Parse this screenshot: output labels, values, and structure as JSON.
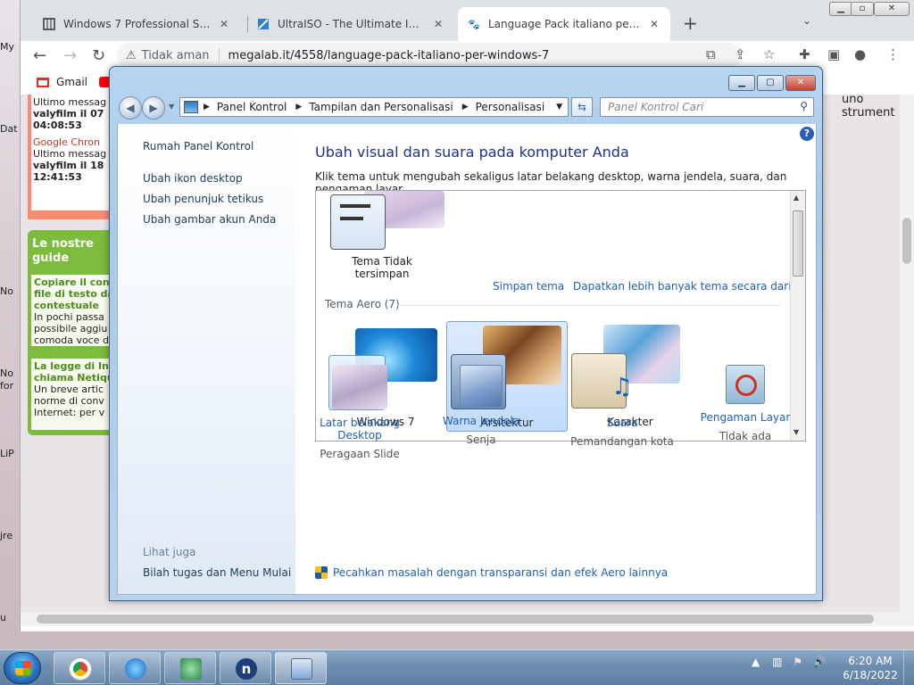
{
  "desktop": {
    "left_labels": [
      "My",
      "Dat",
      "No",
      "No",
      "for",
      "LiP",
      "jre",
      "u"
    ]
  },
  "browser": {
    "tabs": [
      {
        "title": "Windows 7 Professional SP1 (Itali"
      },
      {
        "title": "UltraISO - The Ultimate ISO CD/D"
      },
      {
        "title": "Language Pack italiano per Wind"
      }
    ],
    "address": {
      "security_text": "Tidak aman",
      "url": "megalab.it/4558/language-pack-italiano-per-windows-7"
    },
    "bookmarks": [
      {
        "label": "Gmail"
      }
    ],
    "page": {
      "pink_box_lines": [
        {
          "text": "Ultimo messag",
          "style": "normal"
        },
        {
          "text": "valyfilm il 07",
          "style": "bold"
        },
        {
          "text": "04:08:53",
          "style": "bold"
        },
        {
          "text": "Google Chron",
          "style": "red"
        },
        {
          "text": "Ultimo messag",
          "style": "normal"
        },
        {
          "text": "valyfilm il 18",
          "style": "bold"
        },
        {
          "text": "12:41:53",
          "style": "bold"
        }
      ],
      "green_title": "Le nostre guide",
      "green_items": [
        {
          "title": "Copiare il con file di testo da contestuale",
          "body": "In pochi passa possibile aggiu comoda voce d"
        },
        {
          "title": "La legge di Int chiama Netiqu",
          "body": "Un breve artic norme di conv Internet: per v"
        }
      ],
      "right_text": "uno strument"
    }
  },
  "w7window": {
    "breadcrumb": [
      "Panel Kontrol",
      "Tampilan dan Personalisasi",
      "Personalisasi"
    ],
    "search_placeholder": "Panel Kontrol Cari",
    "sidebar": {
      "links": [
        "Rumah Panel Kontrol",
        "Ubah ikon desktop",
        "Ubah penunjuk tetikus",
        "Ubah gambar akun Anda"
      ],
      "see_also_header": "Lihat juga",
      "see_also_links": [
        "Bilah tugas dan Menu Mulai"
      ]
    },
    "main": {
      "title": "Ubah visual dan suara pada komputer Anda",
      "description": "Klik tema untuk mengubah sekaligus latar belakang desktop, warna jendela, suara, dan pengaman layar.",
      "unsaved_theme": "Tema Tidak tersimpan",
      "save_theme": "Simpan tema",
      "get_more_themes": "Dapatkan lebih banyak tema secara daring",
      "aero_header": "Tema Aero (7)",
      "aero_themes": [
        "Windows 7",
        "Arsitektur",
        "Karakter"
      ],
      "selected_theme": "Arsitektur",
      "bottom_items": [
        {
          "link": "Latar belakang Desktop",
          "sub": "Peragaan Slide"
        },
        {
          "link": "Warna Jendela",
          "sub": "Senja"
        },
        {
          "link": "Suara",
          "sub": "Pemandangan kota"
        },
        {
          "link": "Pengaman Layar",
          "sub": "Tidak ada"
        }
      ],
      "troubleshoot": "Pecahkan masalah dengan transparansi dan efek Aero lainnya"
    }
  },
  "taskbar": {
    "clock_time": "6:20 AM",
    "clock_date": "6/18/2022"
  },
  "colors": {
    "link_blue": "#1f5fb8",
    "title_blue": "#1e3287",
    "accent_green": "#7dbb3c",
    "accent_pink": "#f98a72"
  }
}
